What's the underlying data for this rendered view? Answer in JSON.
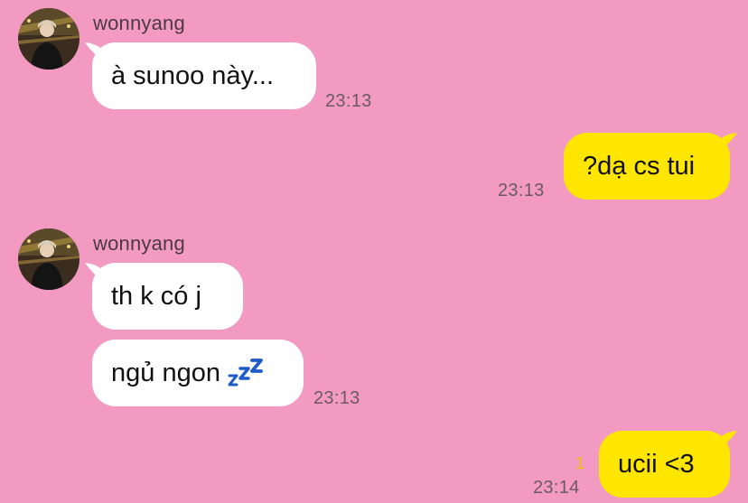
{
  "chat": {
    "messages": [
      {
        "sender": "wonnyang",
        "text": "à sunoo này...",
        "time": "23:13"
      },
      {
        "text": "?dạ cs tui",
        "time": "23:13"
      },
      {
        "sender": "wonnyang",
        "text": "th k có j"
      },
      {
        "text": "ngủ ngon",
        "emoji_icon": "zzz-icon",
        "time": "23:13"
      },
      {
        "text": "ucii <3",
        "time": "23:14",
        "unread": "1"
      }
    ]
  },
  "colors": {
    "background": "#F39AC3",
    "incoming_bubble": "#FFFFFF",
    "outgoing_bubble": "#FFE600",
    "unread": "#F2C100",
    "zzz": "#1E5BC8"
  }
}
